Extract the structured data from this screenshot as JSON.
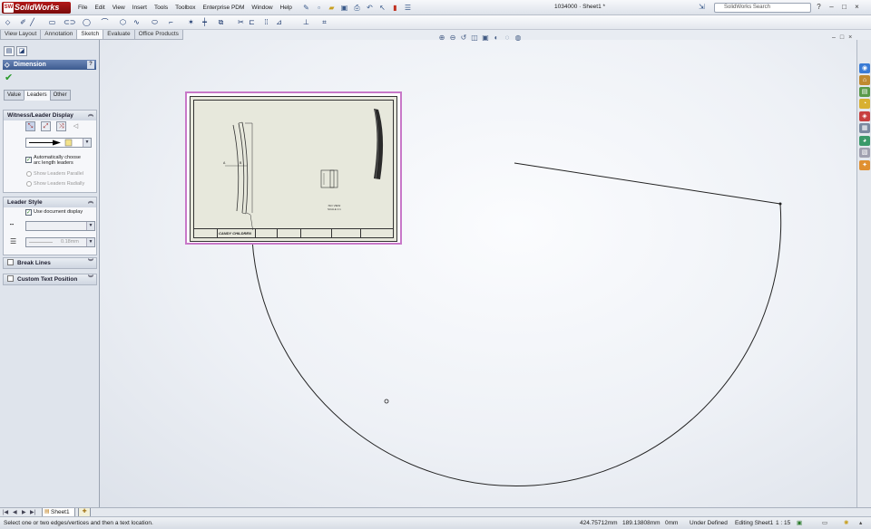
{
  "app": {
    "logo_text": "SolidWorks",
    "logo_mark": "SW",
    "document_title": "1034000 · Sheet1 *",
    "search_placeholder": "SolidWorks Search",
    "help_glyph": "?",
    "window_buttons": [
      "–",
      "□",
      "×"
    ]
  },
  "menu": [
    "File",
    "Edit",
    "View",
    "Insert",
    "Tools",
    "Toolbox",
    "Enterprise PDM",
    "Window",
    "Help"
  ],
  "command_tabs": [
    {
      "label": "View Layout",
      "active": false
    },
    {
      "label": "Annotation",
      "active": false
    },
    {
      "label": "Sketch",
      "active": true
    },
    {
      "label": "Evaluate",
      "active": false
    },
    {
      "label": "Office Products",
      "active": false
    }
  ],
  "property_manager": {
    "title": "Dimension",
    "help": "?",
    "tabs": [
      {
        "label": "Value",
        "active": false
      },
      {
        "label": "Leaders",
        "active": true
      },
      {
        "label": "Other",
        "active": false
      }
    ],
    "witness_group": {
      "title": "Witness/Leader Display",
      "auto_leaders_label": "Automatically choose arc length leaders",
      "auto_leaders_checked": true,
      "radial_parallel_label": "Show Leaders Parallel",
      "radial_radial_label": "Show Leaders Radially"
    },
    "leader_style_group": {
      "title": "Leader Style",
      "use_doc_label": "Use document display",
      "use_doc_checked": true,
      "thickness_value": "0.18mm"
    },
    "break_lines_label": "Break Lines",
    "custom_text_label": "Custom Text Position"
  },
  "drawing_view": {
    "company": "CANDY CHILDREN CO",
    "caption_line1": "ISO VIEW",
    "caption_line2": "SCALE 1:1",
    "dim_a": "A",
    "dim_b": "B"
  },
  "sheet_tab": "Sheet1",
  "status": {
    "message": "Select one or two edges/vertices and then a text location.",
    "x": "424.75712mm",
    "y": "189.13808mm",
    "z": "0mm",
    "state": "Under Defined",
    "editing": "Editing Sheet1",
    "scale": "1 : 15"
  },
  "colors": {
    "pm_header": "#3c5a8f",
    "logo": "#b31818",
    "view_border": "#c878c8",
    "sketch_line": "#222222"
  }
}
